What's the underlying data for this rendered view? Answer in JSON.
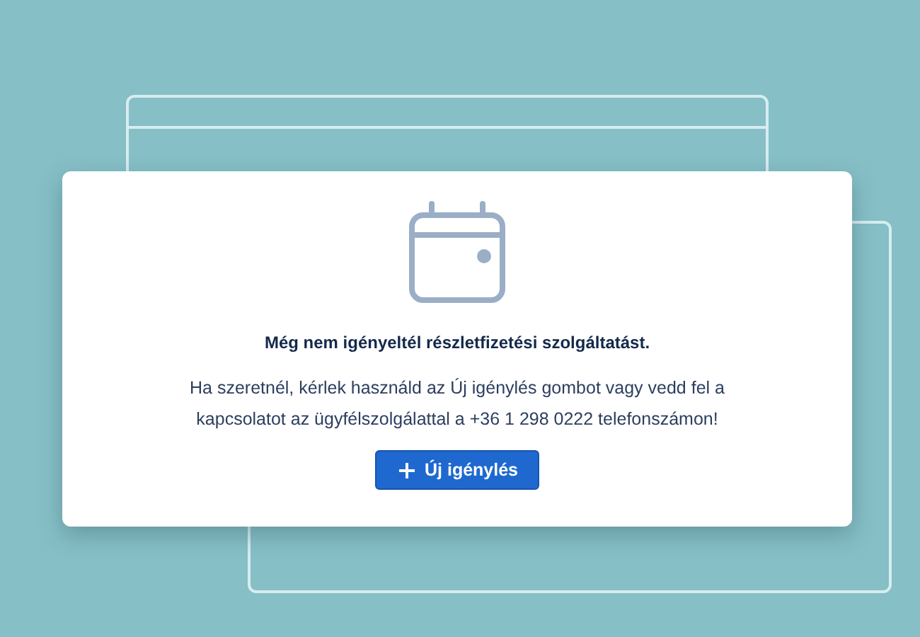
{
  "empty_state": {
    "title": "Még nem igényeltél részletfizetési szolgáltatást.",
    "message": "Ha szeretnél, kérlek használd az Új igénylés gombot vagy vedd fel a kapcsolatot az ügyfélszolgálattal a +36 1 298 0222 telefonszámon!",
    "button": {
      "label": "Új igénylés"
    }
  }
}
